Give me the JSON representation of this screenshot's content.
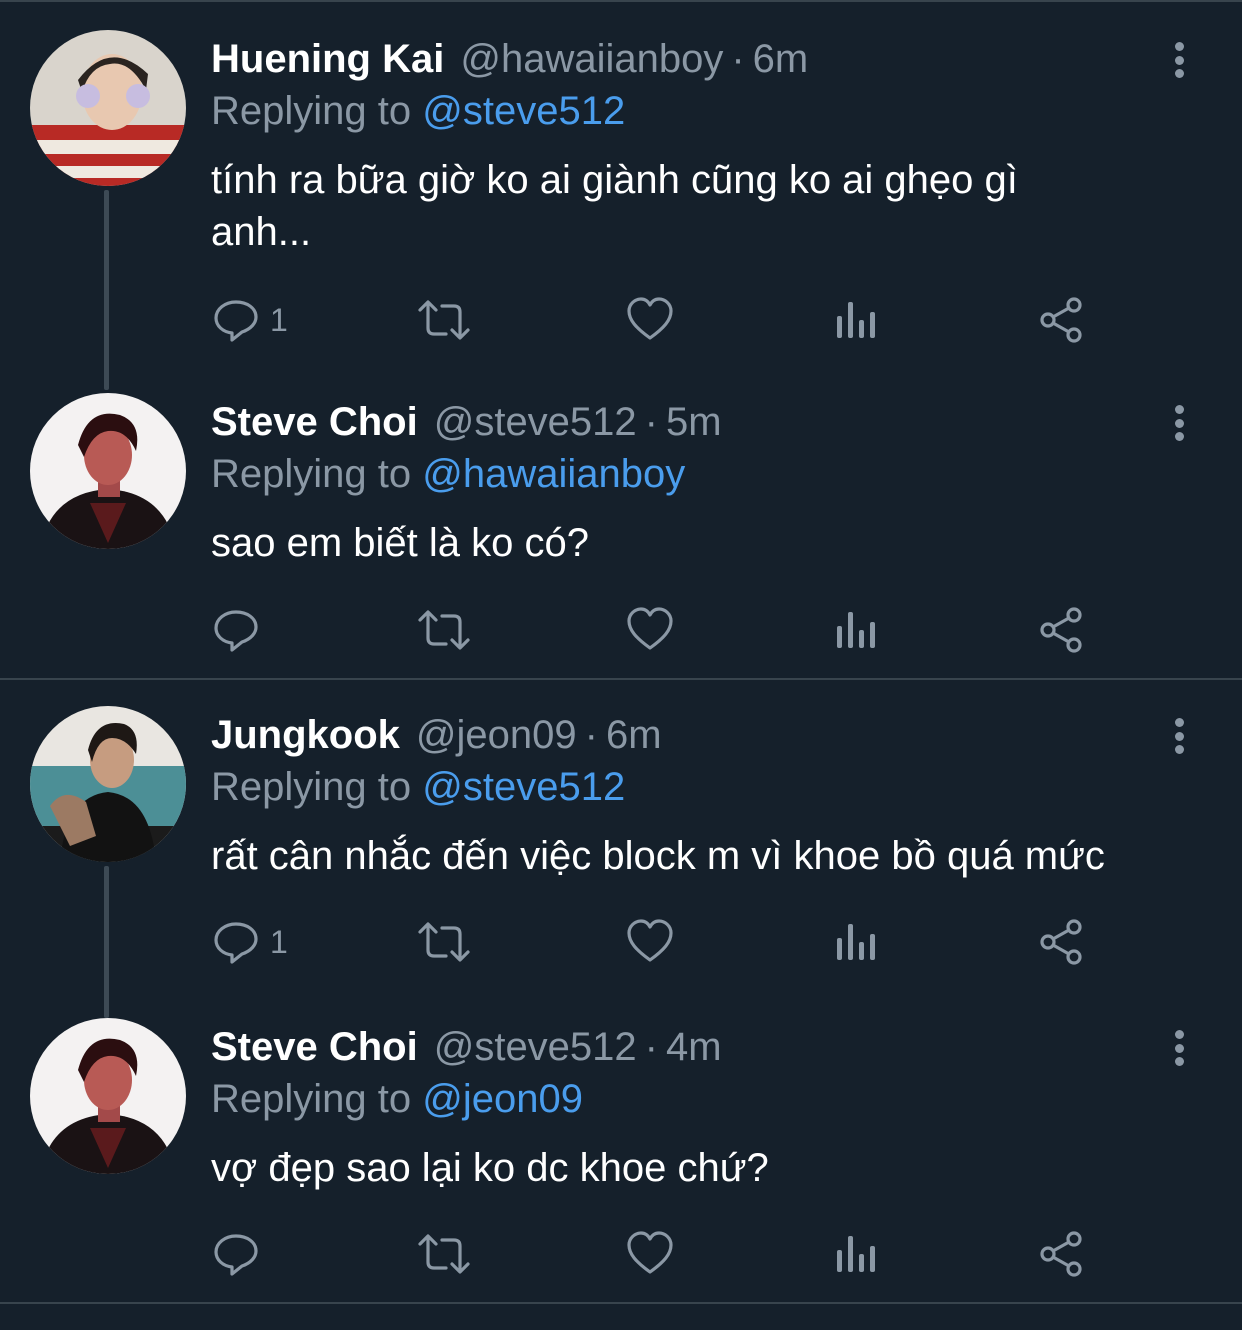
{
  "tweets": [
    {
      "name": "Huening Kai",
      "handle": "@hawaiianboy",
      "sep": "·",
      "time": "6m",
      "replying_prefix": "Replying to",
      "replying_to": "@steve512",
      "text_lines": [
        "tính ra bữa giờ ko ai giành cũng ko ai ghẹo gì",
        "anh..."
      ],
      "reply_count": "1"
    },
    {
      "name": "Steve Choi",
      "handle": "@steve512",
      "sep": "·",
      "time": "5m",
      "replying_prefix": "Replying to",
      "replying_to": "@hawaiianboy",
      "text_lines": [
        "sao em biết là ko có?"
      ],
      "reply_count": ""
    },
    {
      "name": "Jungkook",
      "handle": "@jeon09",
      "sep": "·",
      "time": "6m",
      "replying_prefix": "Replying to",
      "replying_to": "@steve512",
      "text_lines": [
        "rất cân nhắc đến việc block m vì khoe bồ quá mức"
      ],
      "reply_count": "1"
    },
    {
      "name": "Steve Choi",
      "handle": "@steve512",
      "sep": "·",
      "time": "4m",
      "replying_prefix": "Replying to",
      "replying_to": "@jeon09",
      "text_lines": [
        "vợ đẹp sao lại ko dc khoe chứ?"
      ],
      "reply_count": ""
    }
  ],
  "icons": {
    "reply": "reply-icon",
    "retweet": "retweet-icon",
    "like": "heart-icon",
    "analytics": "analytics-icon",
    "share": "share-icon",
    "more": "more-vertical-icon"
  },
  "colors": {
    "background": "#15202b",
    "muted": "#8b98a5",
    "link": "#4a9ded",
    "divider": "#38444d"
  }
}
